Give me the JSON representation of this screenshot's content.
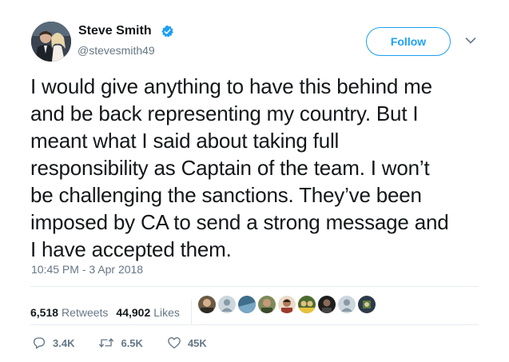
{
  "author": {
    "name": "Steve Smith",
    "handle": "@stevesmith49",
    "verified": true,
    "avatar_icon": "avatar-photo"
  },
  "follow_label": "Follow",
  "tweet": {
    "lines": [
      "I would give anything to have this behind me",
      "and be back representing my country. But I",
      "meant what I said about taking full",
      "responsibility as Captain of the team. I won’t",
      "be challenging the sanctions. They’ve been",
      "imposed by CA to send a strong message and",
      "I have accepted them."
    ],
    "timestamp": "10:45 PM - 3 Apr 2018"
  },
  "stats": {
    "retweets_count": "6,518",
    "retweets_label": "Retweets",
    "likes_count": "44,902",
    "likes_label": "Likes"
  },
  "actions": {
    "reply_count": "3.4K",
    "retweet_count": "6.5K",
    "like_count": "45K"
  },
  "colors": {
    "accent": "#1da1f2",
    "muted": "#657786",
    "text": "#14171a",
    "divider": "#e6ecf0"
  }
}
